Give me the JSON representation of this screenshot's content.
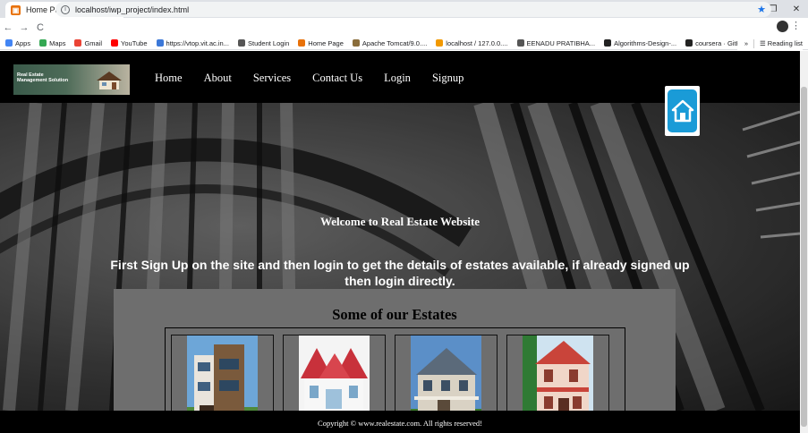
{
  "browser": {
    "tab_title": "Home Page",
    "tab_close": "×",
    "new_tab": "+",
    "url": "localhost/iwp_project/index.html",
    "controls": [
      "–",
      "❐",
      "✕"
    ],
    "bookmarks": [
      {
        "label": "Apps",
        "color": "#4285f4"
      },
      {
        "label": "Maps",
        "color": "#34a853"
      },
      {
        "label": "Gmail",
        "color": "#ea4335"
      },
      {
        "label": "YouTube",
        "color": "#ff0000"
      },
      {
        "label": "https://vtop.vit.ac.in...",
        "color": "#3c78d8"
      },
      {
        "label": "Student Login",
        "color": "#555555"
      },
      {
        "label": "Home Page",
        "color": "#e8710a"
      },
      {
        "label": "Apache Tomcat/9.0....",
        "color": "#8a6d3b"
      },
      {
        "label": "localhost / 127.0.0....",
        "color": "#f29900"
      },
      {
        "label": "EENADU PRATIBHA...",
        "color": "#555555"
      },
      {
        "label": "Algorithms-Design-...",
        "color": "#222222"
      },
      {
        "label": "coursera · GitHub T...",
        "color": "#222222"
      }
    ],
    "bookmarks_more": "»",
    "reading_list": "Reading list"
  },
  "site": {
    "logo_text": "Real Estate Management Solution",
    "nav": [
      "Home",
      "About",
      "Services",
      "Contact Us",
      "Login",
      "Signup"
    ],
    "welcome": "Welcome to Real Estate Website",
    "signup_message": "First Sign Up on the site and then login to get the details of estates available, if already signed up then login directly.",
    "estates_title": "Some of our Estates",
    "estates": [
      {
        "name": "estate-1",
        "palette": [
          "#7a5a3c",
          "#e9e4dc",
          "#3f7dbb"
        ]
      },
      {
        "name": "estate-2",
        "palette": [
          "#c8313b",
          "#f2f2f2",
          "#4c9a3d"
        ]
      },
      {
        "name": "estate-3",
        "palette": [
          "#d9d2c4",
          "#5b7fa8",
          "#3d7d2e"
        ]
      },
      {
        "name": "estate-4",
        "palette": [
          "#c9443a",
          "#f0d6c8",
          "#2f7a34"
        ]
      }
    ],
    "footer": "Copyright © www.realestate.com. All rights reserved!",
    "accent_color": "#1a9bd7"
  }
}
